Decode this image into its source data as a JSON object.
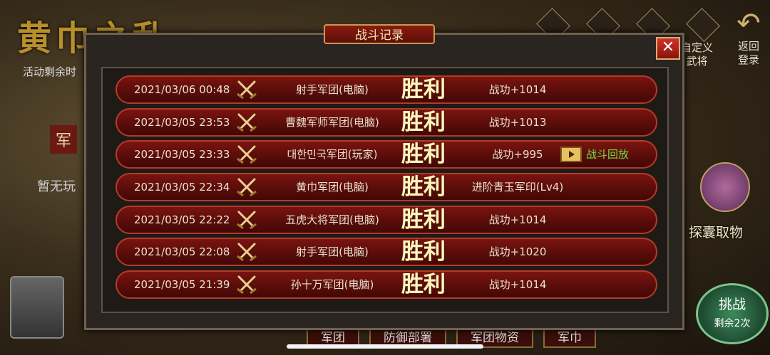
{
  "background": {
    "title": "黄巾之乱",
    "timer_text": "活动剩余时",
    "army_label": "军",
    "no_player": "暂无玩",
    "custom_general": [
      "自定义",
      "武将"
    ],
    "return_label": [
      "返回",
      "登录"
    ],
    "bag_label": "探囊取物",
    "challenge": {
      "label": "挑战",
      "remaining": "剩余2次"
    },
    "bottom_tabs": [
      "军团",
      "防御部署",
      "军团物资",
      "军巾"
    ]
  },
  "modal": {
    "title": "战斗记录",
    "close_symbol": "✕",
    "records": [
      {
        "datetime": "2021/03/06 00:48",
        "opponent": "射手军团(电脑)",
        "result": "胜利",
        "reward": "战功+1014",
        "replay": ""
      },
      {
        "datetime": "2021/03/05 23:53",
        "opponent": "曹魏军师军团(电脑)",
        "result": "胜利",
        "reward": "战功+1013",
        "replay": ""
      },
      {
        "datetime": "2021/03/05 23:33",
        "opponent": "대한민국军团(玩家)",
        "result": "胜利",
        "reward": "战功+995",
        "replay": "战斗回放"
      },
      {
        "datetime": "2021/03/05 22:34",
        "opponent": "黄巾军团(电脑)",
        "result": "胜利",
        "reward": "进阶青玉军印(Lv4)",
        "replay": ""
      },
      {
        "datetime": "2021/03/05 22:22",
        "opponent": "五虎大将军团(电脑)",
        "result": "胜利",
        "reward": "战功+1014",
        "replay": ""
      },
      {
        "datetime": "2021/03/05 22:08",
        "opponent": "射手军团(电脑)",
        "result": "胜利",
        "reward": "战功+1020",
        "replay": ""
      },
      {
        "datetime": "2021/03/05 21:39",
        "opponent": "孙十万军团(电脑)",
        "result": "胜利",
        "reward": "战功+1014",
        "replay": ""
      }
    ]
  },
  "colors": {
    "row_fill": "#5a0d0a",
    "row_border": "#b43a2a",
    "replay_text": "#6fe04a",
    "result_text": "#fff4c0"
  },
  "icons": {
    "battle": "crossed-swords-icon",
    "replay": "film-replay-icon",
    "close": "close-icon"
  }
}
